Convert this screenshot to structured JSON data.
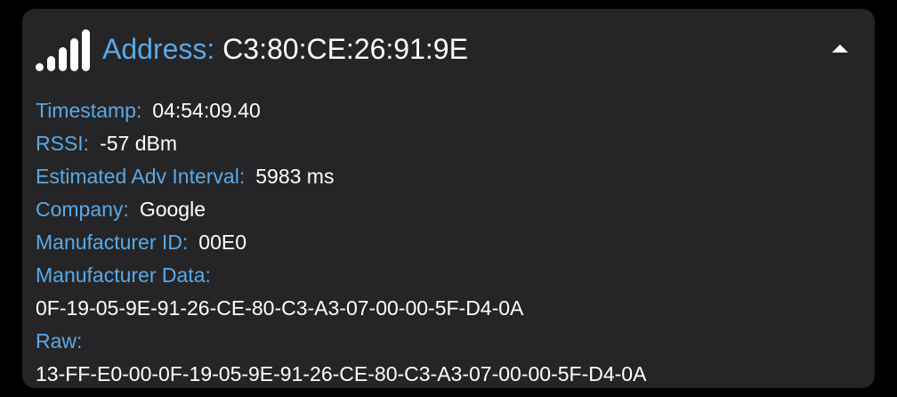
{
  "device": {
    "signal_icon": "signal-strength-icon",
    "signal_level": 5,
    "signal_level_max": 5,
    "address_label": "Address:",
    "address_value": "C3:80:CE:26:91:9E",
    "collapse_icon": "caret-up-icon"
  },
  "fields": [
    {
      "label": "Timestamp:",
      "value": "04:54:09.40"
    },
    {
      "label": "RSSI:",
      "value": "-57 dBm"
    },
    {
      "label": "Estimated Adv Interval:",
      "value": "5983 ms"
    },
    {
      "label": "Company:",
      "value": "Google"
    },
    {
      "label": "Manufacturer ID:",
      "value": "00E0"
    }
  ],
  "manufacturer_data": {
    "label": "Manufacturer Data:",
    "value": "0F-19-05-9E-91-26-CE-80-C3-A3-07-00-00-5F-D4-0A"
  },
  "raw": {
    "label": "Raw:",
    "value": "13-FF-E0-00-0F-19-05-9E-91-26-CE-80-C3-A3-07-00-00-5F-D4-0A"
  },
  "colors": {
    "background": "#000000",
    "card": "#252527",
    "label": "#5aa9e6",
    "value": "#ffffff"
  }
}
